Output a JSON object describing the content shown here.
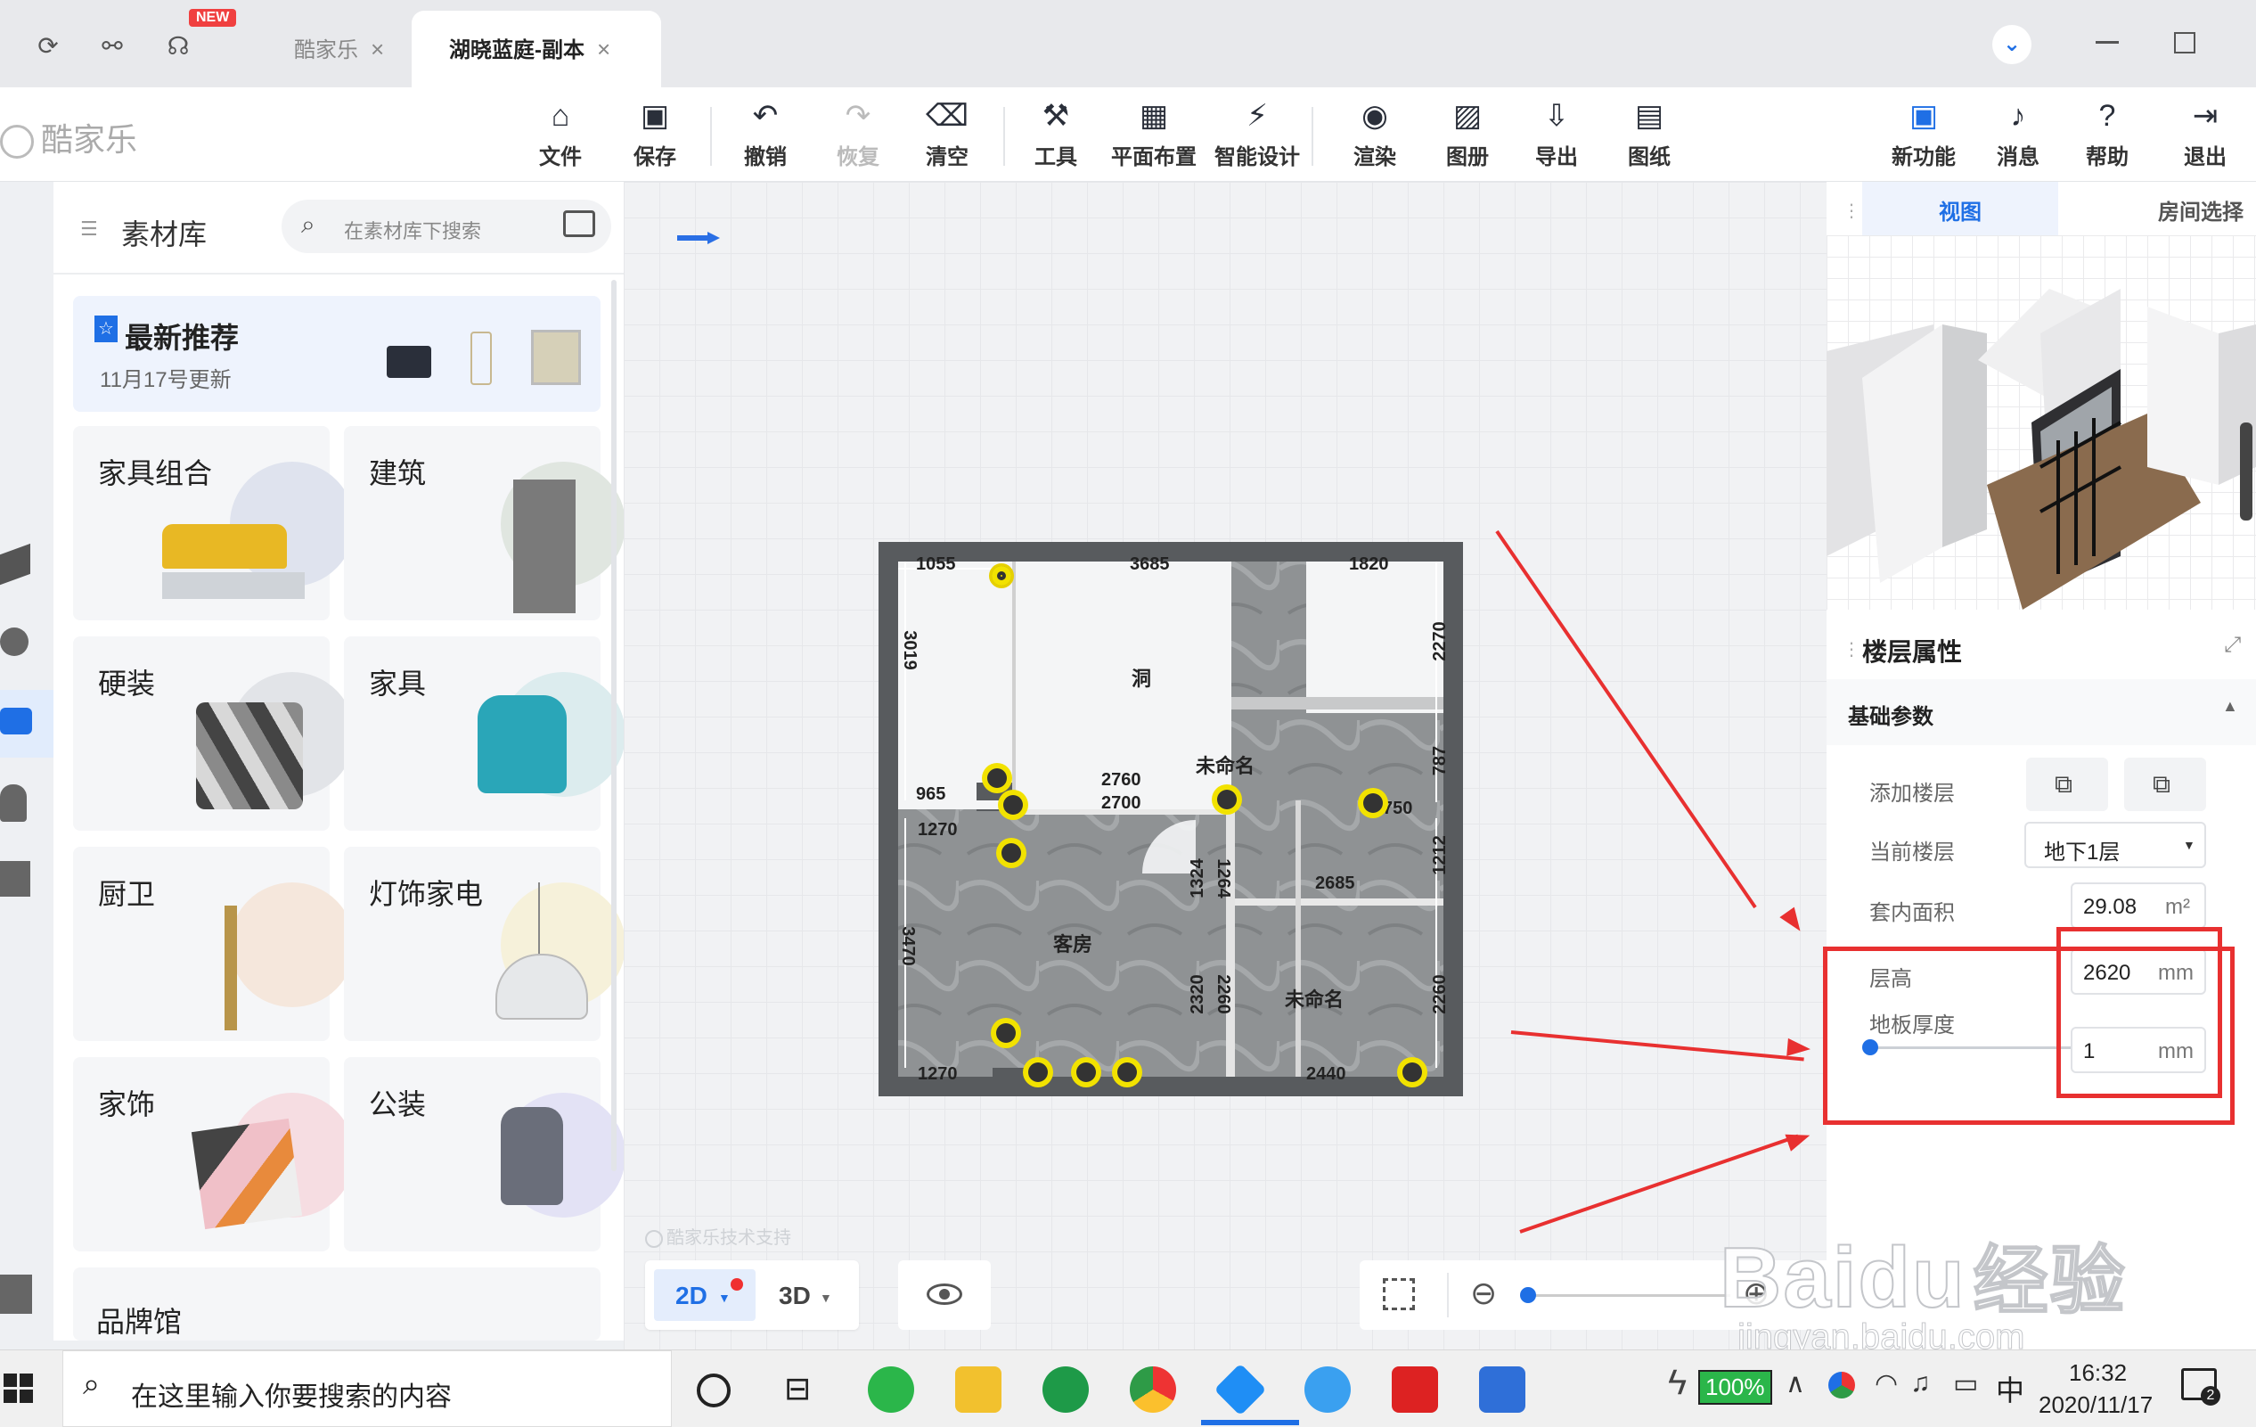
{
  "tabs": {
    "new_badge": "NEW",
    "tab1": "酷家乐",
    "tab2": "湖晓蓝庭-副本",
    "close": "×"
  },
  "logo": "酷家乐",
  "toolbar": {
    "file": "文件",
    "save": "保存",
    "undo": "撤销",
    "redo": "恢复",
    "clear": "清空",
    "tools": "工具",
    "layout": "平面布置",
    "smart": "智能设计",
    "render": "渲染",
    "album": "图册",
    "export": "导出",
    "drawings": "图纸",
    "new_feature": "新功能",
    "messages": "消息",
    "help": "帮助",
    "exit": "退出"
  },
  "library": {
    "title": "素材库",
    "search_placeholder": "在素材库下搜索",
    "featured_title": "最新推荐",
    "featured_date": "11月17号更新",
    "categories": [
      "家具组合",
      "建筑",
      "硬装",
      "家具",
      "厨卫",
      "灯饰家电",
      "家饰",
      "公装"
    ],
    "brand": "品牌馆"
  },
  "floorplan": {
    "dims": [
      "1055",
      "3685",
      "1820",
      "3019",
      "2270",
      "965",
      "2760",
      "2700",
      "1270",
      "787",
      "750",
      "1212",
      "1324",
      "1264",
      "2685",
      "3470",
      "2320",
      "2260",
      "2260",
      "1270",
      "2440"
    ],
    "rooms": [
      "洞",
      "未命名",
      "客房",
      "未命名"
    ]
  },
  "canvas": {
    "watermark": "酷家乐技术支持",
    "mode_2d": "2D",
    "mode_3d": "3D"
  },
  "right_panel": {
    "tab_view": "视图",
    "tab_room": "房间选择",
    "section_title": "楼层属性",
    "basic_params": "基础参数",
    "add_floor": "添加楼层",
    "current_floor_label": "当前楼层",
    "current_floor_value": "地下1层",
    "area_label": "套内面积",
    "area_value": "29.08",
    "area_unit": "m²",
    "height_label": "层高",
    "height_value": "2620",
    "height_unit": "mm",
    "thickness_label": "地板厚度",
    "thickness_value": "1",
    "thickness_unit": "mm"
  },
  "watermark": {
    "baidu": "Baidu",
    "jingyan": "经验",
    "url": "jingyan.baidu.com"
  },
  "taskbar": {
    "search_placeholder": "在这里输入你要搜索的内容",
    "battery": "100%",
    "ime": "中",
    "time": "16:32",
    "date": "2020/11/17",
    "notif_count": "2"
  },
  "colors": {
    "accent": "#1f6fe5",
    "annotation_red": "#e83030",
    "marker_yellow": "#f2e200"
  }
}
